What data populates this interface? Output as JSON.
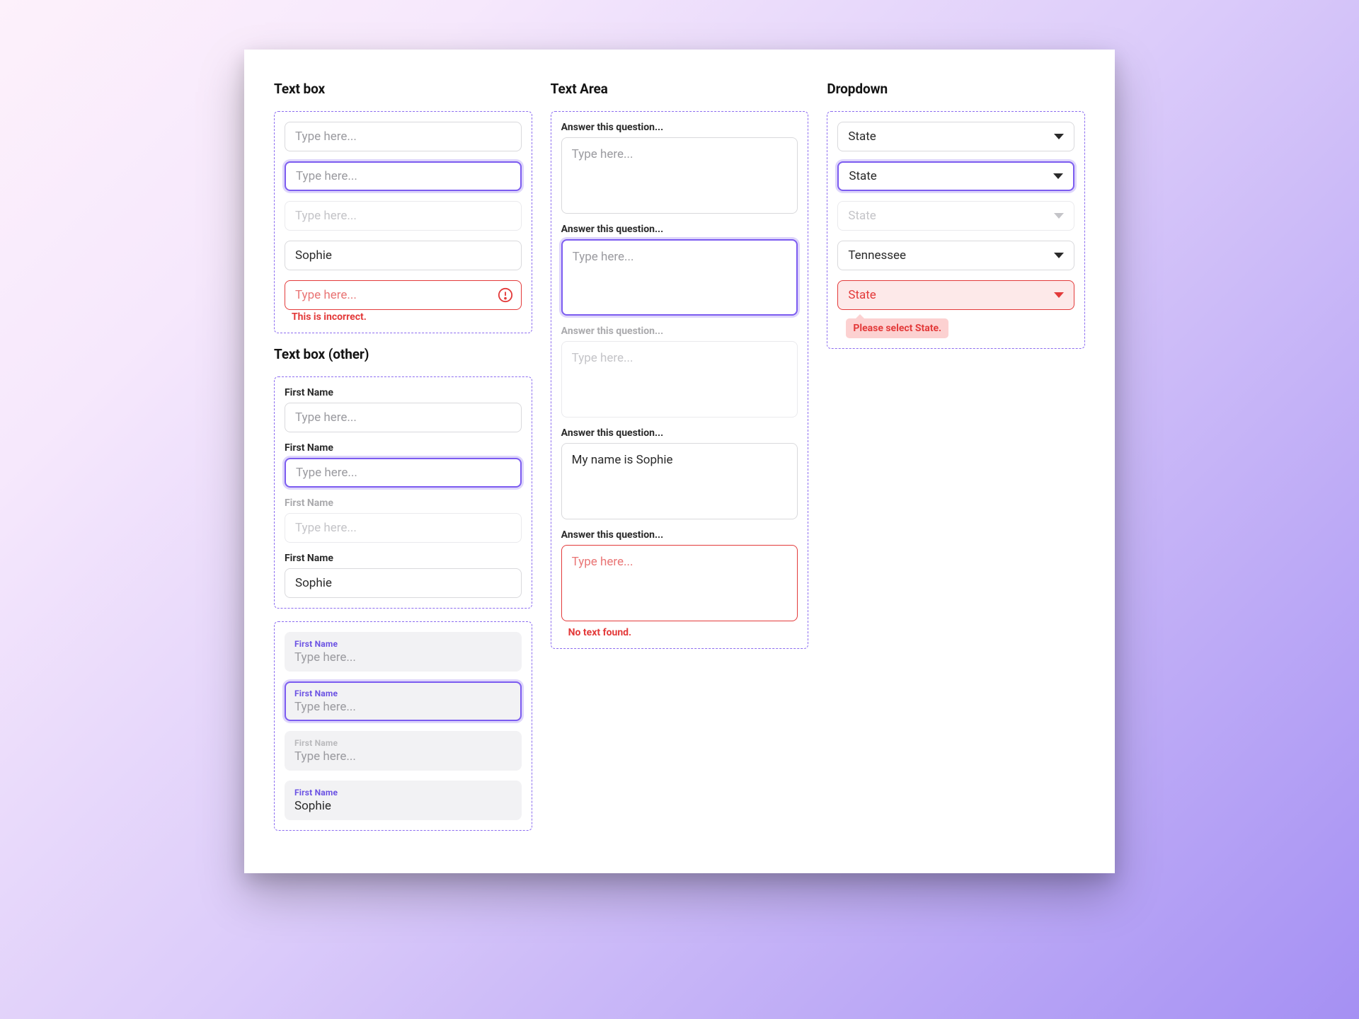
{
  "sections": {
    "textbox": "Text box",
    "textbox_other": "Text box (other)",
    "textarea": "Text Area",
    "dropdown": "Dropdown"
  },
  "textbox": {
    "placeholder": "Type here...",
    "filled_value": "Sophie",
    "error_msg": "This is incorrect."
  },
  "textbox_labeled": {
    "label": "First Name",
    "placeholder": "Type here...",
    "filled_value": "Sophie"
  },
  "textbox_filled_style": {
    "label": "First Name",
    "placeholder": "Type here...",
    "filled_value": "Sophie"
  },
  "textarea": {
    "label": "Answer this question...",
    "placeholder": "Type here...",
    "filled_value": "My name is Sophie",
    "error_msg": "No text found."
  },
  "dropdown": {
    "label": "State",
    "selected_value": "Tennessee",
    "error_msg": "Please select State."
  }
}
